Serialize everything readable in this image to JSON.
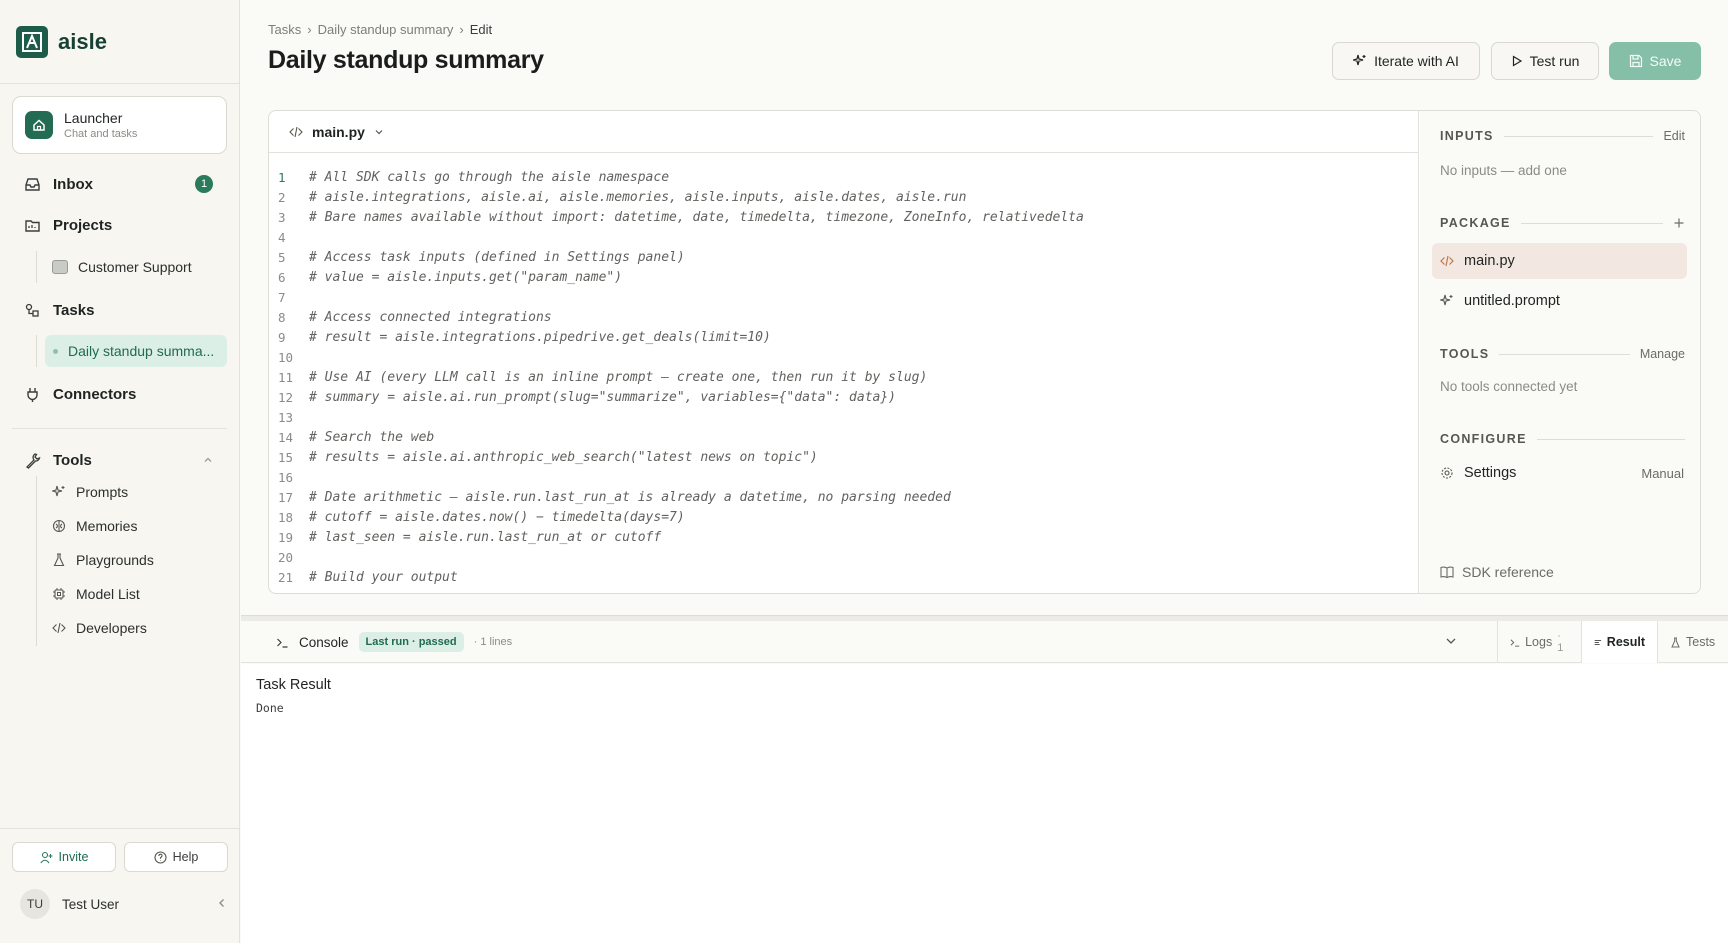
{
  "brand": {
    "name": "aisle"
  },
  "launcher": {
    "title": "Launcher",
    "subtitle": "Chat and tasks"
  },
  "nav": {
    "inbox": {
      "label": "Inbox",
      "badge": "1"
    },
    "projects": {
      "label": "Projects",
      "items": [
        "Customer Support"
      ]
    },
    "tasks": {
      "label": "Tasks",
      "items": [
        "Daily standup summa..."
      ]
    },
    "connectors": {
      "label": "Connectors"
    },
    "tools": {
      "label": "Tools",
      "items": [
        "Prompts",
        "Memories",
        "Playgrounds",
        "Model List",
        "Developers"
      ]
    }
  },
  "footer": {
    "invite": "Invite",
    "help": "Help",
    "user_initials": "TU",
    "user_name": "Test User"
  },
  "breadcrumb": [
    "Tasks",
    "Daily standup summary",
    "Edit"
  ],
  "page": {
    "title": "Daily standup summary"
  },
  "header_buttons": {
    "iterate": "Iterate with AI",
    "test_run": "Test run",
    "save": "Save"
  },
  "editor": {
    "file_tab": "main.py",
    "lines": [
      "# All SDK calls go through the aisle namespace",
      "# aisle.integrations, aisle.ai, aisle.memories, aisle.inputs, aisle.dates, aisle.run",
      "# Bare names available without import: datetime, date, timedelta, timezone, ZoneInfo, relativedelta",
      "",
      "# Access task inputs (defined in Settings panel)",
      "# value = aisle.inputs.get(\"param_name\")",
      "",
      "# Access connected integrations",
      "# result = aisle.integrations.pipedrive.get_deals(limit=10)",
      "",
      "# Use AI (every LLM call is an inline prompt — create one, then run it by slug)",
      "# summary = aisle.ai.run_prompt(slug=\"summarize\", variables={\"data\": data})",
      "",
      "# Search the web",
      "# results = aisle.ai.anthropic_web_search(\"latest news on topic\")",
      "",
      "# Date arithmetic — aisle.run.last_run_at is already a datetime, no parsing needed",
      "# cutoff = aisle.dates.now() − timedelta(days=7)",
      "# last_seen = aisle.run.last_run_at or cutoff",
      "",
      "# Build your output"
    ]
  },
  "side": {
    "inputs": {
      "heading": "INPUTS",
      "action": "Edit",
      "empty": "No inputs — add one"
    },
    "package": {
      "heading": "PACKAGE",
      "files": [
        "main.py",
        "untitled.prompt"
      ]
    },
    "tools": {
      "heading": "TOOLS",
      "action": "Manage",
      "empty": "No tools connected yet"
    },
    "configure": {
      "heading": "CONFIGURE",
      "settings_label": "Settings",
      "settings_value": "Manual"
    },
    "sdk_reference": "SDK reference"
  },
  "console": {
    "title": "Console",
    "status": "Last run · passed",
    "lines": "· 1 lines",
    "tabs": {
      "logs": "Logs",
      "logs_count": "· 1",
      "result": "Result",
      "tests": "Tests"
    },
    "result_title": "Task Result",
    "result_value": "Done"
  },
  "colors": {
    "brand": "#1c5c48",
    "accent": "#2a7a5b",
    "save_button": "#86bfa8",
    "active_nav_bg": "#dcefe7"
  }
}
